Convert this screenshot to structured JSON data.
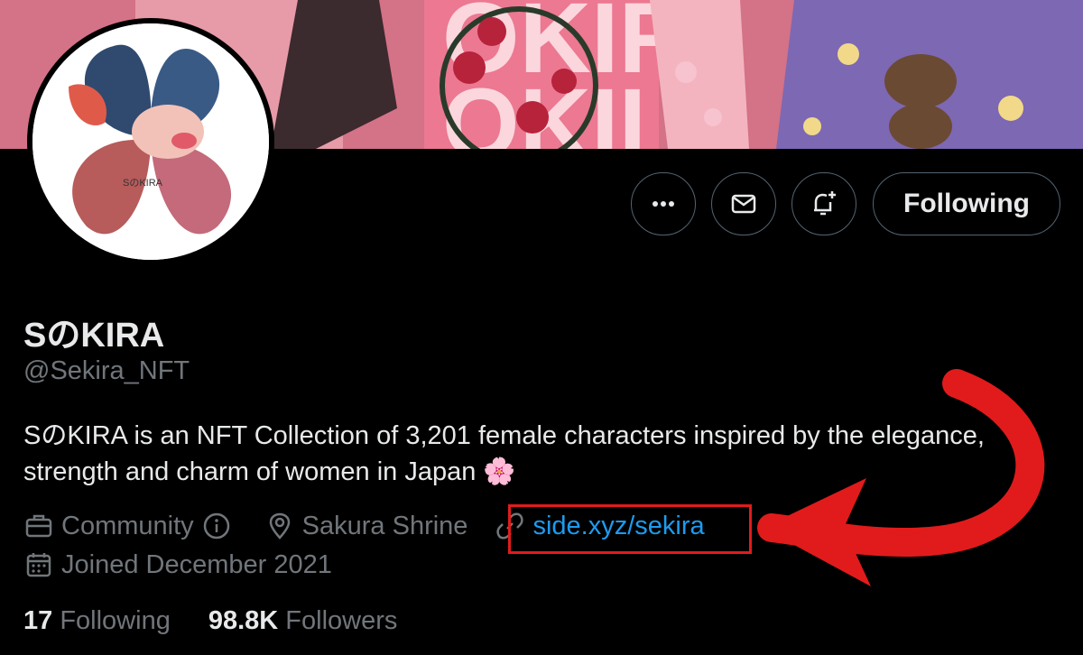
{
  "profile": {
    "display_name": "SのKIRA",
    "handle": "@Sekira_NFT",
    "bio_line1": "SのKIRA is an NFT Collection of 3,201 female characters inspired by the elegance,",
    "bio_line2": "strength and charm of women in Japan",
    "bio_emoji": "🌸",
    "category": "Community",
    "location": "Sakura Shrine",
    "website": "side.xyz/sekira",
    "joined": "Joined December 2021"
  },
  "stats": {
    "following_count": "17",
    "following_label": "Following",
    "followers_count": "98.8K",
    "followers_label": "Followers"
  },
  "actions": {
    "follow_label": "Following",
    "more_icon": "more-icon",
    "message_icon": "mail-icon",
    "notify_icon": "bell-plus-icon"
  },
  "colors": {
    "link": "#1d9bf0",
    "annotation": "#e11b1b",
    "muted": "#71767b"
  }
}
